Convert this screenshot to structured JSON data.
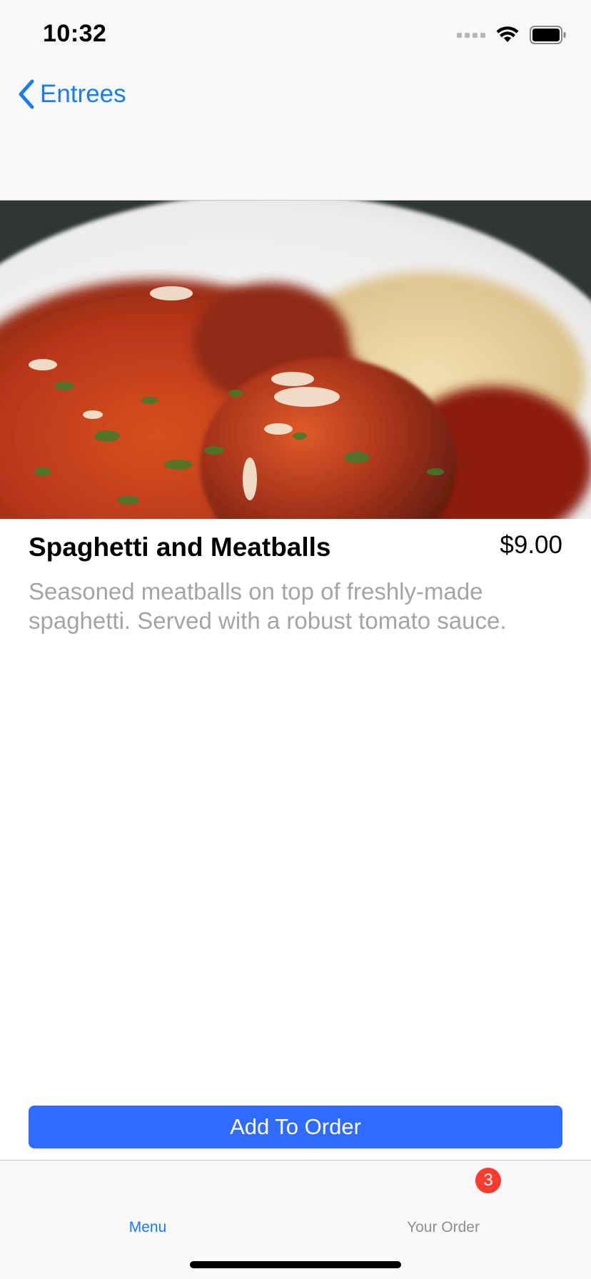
{
  "status_bar": {
    "time": "10:32"
  },
  "nav": {
    "back_label": "Entrees"
  },
  "item": {
    "image_icon": "food-photo",
    "name": "Spaghetti and Meatballs",
    "price": "$9.00",
    "description": "Seasoned meatballs on top of freshly-made spaghetti. Served with a robust tomato sauce."
  },
  "actions": {
    "add_label": "Add To Order"
  },
  "tab_bar": {
    "tabs": [
      {
        "label": "Menu",
        "selected": true
      },
      {
        "label": "Your Order",
        "selected": false,
        "badge": "3"
      }
    ]
  },
  "colors": {
    "accent": "#1a7cf5",
    "button": "#2f6bff",
    "badge": "#ff3b30",
    "secondary_text": "#a3a3a8"
  }
}
